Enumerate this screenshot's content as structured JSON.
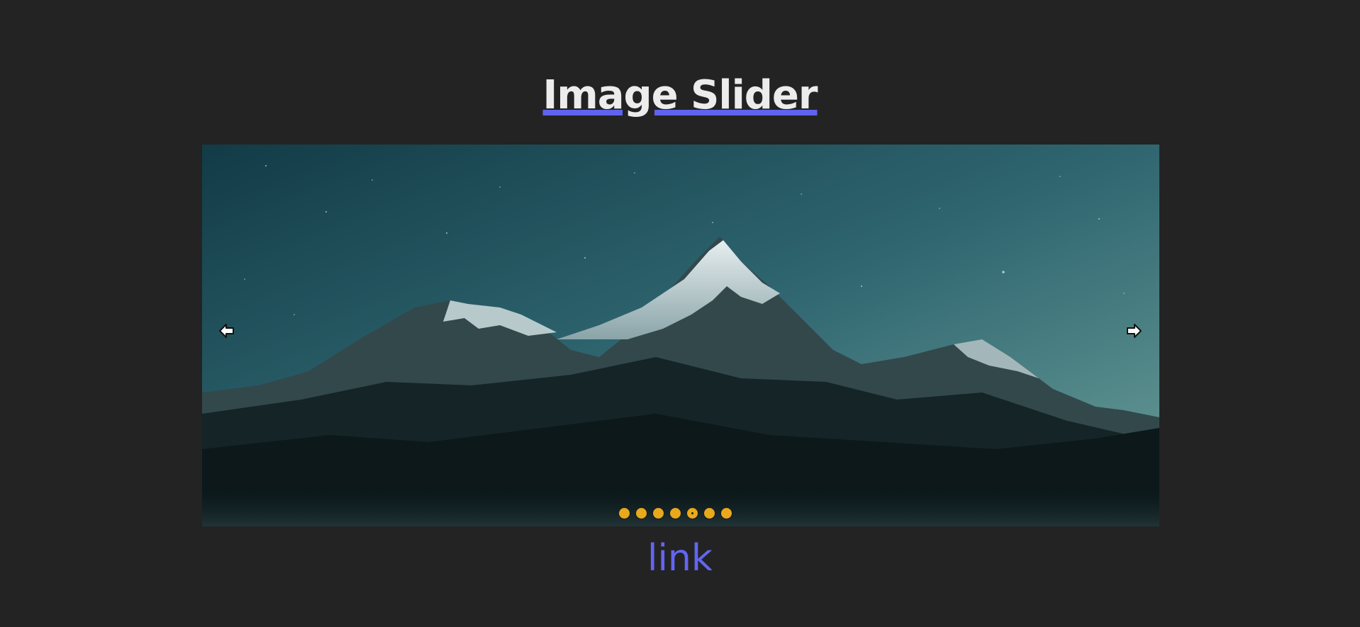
{
  "page": {
    "title": "Image Slider",
    "link_label": "link"
  },
  "slider": {
    "image_alt": "mountain-landscape",
    "arrow_left_icon": "arrow-left-icon",
    "arrow_right_icon": "arrow-right-icon",
    "dot_count": 7,
    "active_dot_index": 4
  },
  "colors": {
    "background": "#232323",
    "title_text": "#ececec",
    "title_underline": "#5f63ee",
    "dot_fill": "#e9a91c",
    "link": "#6366f1"
  }
}
